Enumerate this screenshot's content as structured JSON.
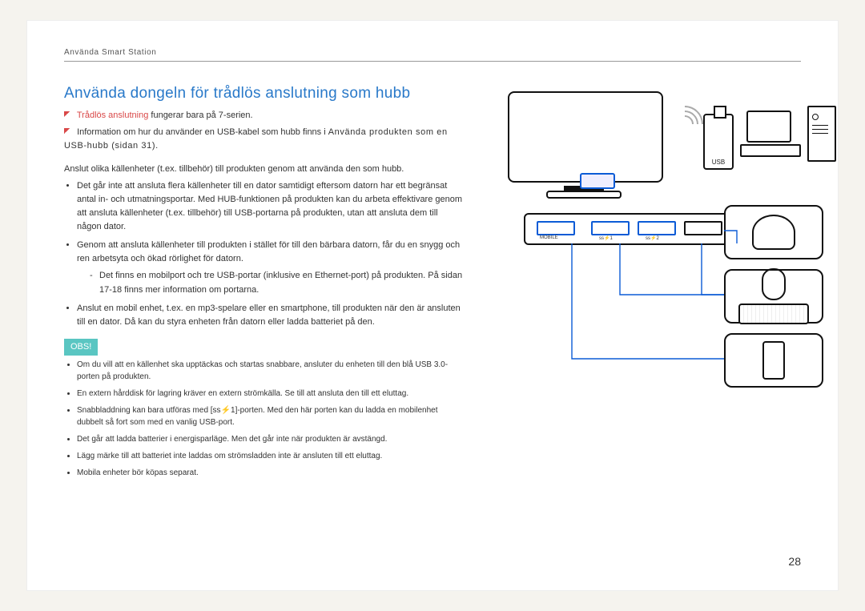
{
  "header": {
    "section": "Använda Smart Station"
  },
  "title": "Använda dongeln för trådlös anslutning som hubb",
  "intro": {
    "l1_red": "Trådlös anslutning",
    "l1_rest": " fungerar bara på 7-serien.",
    "l2a": "Information om hur du använder en USB-kabel som hubb finns i ",
    "l2b": "Använda produkten som en USB-hubb (sidan 31)",
    "l2c": "."
  },
  "para1": "Anslut olika källenheter (t.ex. tillbehör) till produkten genom att använda den som hubb.",
  "bullets1": [
    "Det går inte att ansluta flera källenheter till en dator samtidigt eftersom datorn har ett begränsat antal in- och utmatningsportar. Med HUB-funktionen på produkten kan du arbeta effektivare genom att ansluta källenheter (t.ex. tillbehör) till USB-portarna på produkten, utan att ansluta dem till någon dator.",
    "Genom att ansluta källenheter till produkten i stället för till den bärbara datorn, får du en snygg och ren arbetsyta och ökad rörlighet för datorn."
  ],
  "sub_dash": "Det finns en mobilport och tre USB-portar (inklusive en Ethernet-port) på produkten. På sidan 17-18 finns mer information om portarna.",
  "bullets1b": [
    "Anslut en mobil enhet, t.ex. en mp3-spelare eller en smartphone, till produkten när den är ansluten till en dator. Då kan du styra enheten från datorn eller ladda batteriet på den."
  ],
  "obs_label": "OBS!",
  "obs": [
    "Om du vill att en källenhet ska upptäckas och startas snabbare, ansluter du enheten till den blå USB 3.0-porten på produkten.",
    "En extern hårddisk för lagring kräver en extern strömkälla. Se till att ansluta den till ett eluttag.",
    "Snabbladdning kan bara utföras med [ss⚡1]-porten. Med den här porten kan du ladda en mobilenhet dubbelt så fort som med en vanlig USB-port.",
    "Det går att ladda batterier i energisparläge. Men det går inte när produkten är avstängd.",
    "Lägg märke till att batteriet inte laddas om strömsladden inte är ansluten till ett eluttag.",
    "Mobila enheter bör köpas separat."
  ],
  "hub_labels": {
    "mobile": "MOBILE",
    "ss1": "ss⚡1",
    "ss2": "ss⚡2"
  },
  "usb_stick_label": "USB",
  "page_number": "28"
}
